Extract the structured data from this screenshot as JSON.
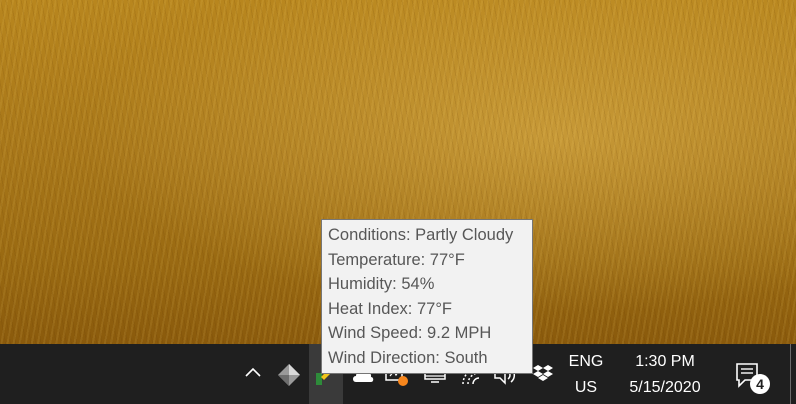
{
  "tooltip": {
    "lines": [
      "Conditions: Partly Cloudy",
      "Temperature: 77°F",
      "Humidity: 54%",
      "Heat Index: 77°F",
      "Wind Speed: 9.2 MPH",
      "Wind Direction: South"
    ]
  },
  "taskbar": {
    "icons": [
      "show-hidden-icons-chevron",
      "diamond-app-icon",
      "weather-app-icon",
      "cloud-icon",
      "battery-charging-icon",
      "display-icon",
      "wifi-icon",
      "speaker-icon",
      "dropbox-icon"
    ],
    "language": {
      "lang": "ENG",
      "region": "US"
    },
    "clock": {
      "time": "1:30 PM",
      "date": "5/15/2020"
    },
    "notifications": {
      "count": "4"
    }
  }
}
